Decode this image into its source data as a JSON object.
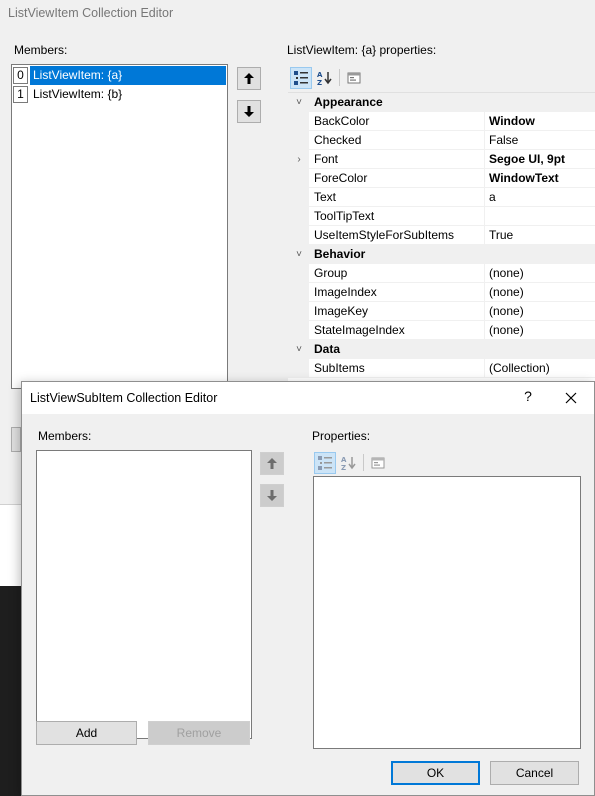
{
  "back_window": {
    "title": "ListViewItem Collection Editor",
    "members_label": "Members:",
    "members": [
      {
        "index": "0",
        "label": "ListViewItem: {a}",
        "selected": true
      },
      {
        "index": "1",
        "label": "ListViewItem: {b}",
        "selected": false
      }
    ],
    "properties_label": "ListViewItem: {a} properties:",
    "property_grid": {
      "categories": [
        {
          "name": "Appearance",
          "properties": [
            {
              "name": "BackColor",
              "value": "Window",
              "bold": true
            },
            {
              "name": "Checked",
              "value": "False",
              "bold": false
            },
            {
              "name": "Font",
              "value": "Segoe UI, 9pt",
              "bold": true,
              "expandable": true
            },
            {
              "name": "ForeColor",
              "value": "WindowText",
              "bold": true
            },
            {
              "name": "Text",
              "value": "a",
              "bold": false
            },
            {
              "name": "ToolTipText",
              "value": "",
              "bold": false
            },
            {
              "name": "UseItemStyleForSubItems",
              "value": "True",
              "bold": false
            }
          ]
        },
        {
          "name": "Behavior",
          "properties": [
            {
              "name": "Group",
              "value": "(none)",
              "bold": false
            },
            {
              "name": "ImageIndex",
              "value": "(none)",
              "bold": false
            },
            {
              "name": "ImageKey",
              "value": "(none)",
              "bold": false
            },
            {
              "name": "StateImageIndex",
              "value": "(none)",
              "bold": false
            }
          ]
        },
        {
          "name": "Data",
          "properties": [
            {
              "name": "SubItems",
              "value": "(Collection)",
              "bold": false
            }
          ]
        }
      ]
    }
  },
  "dialog": {
    "title": "ListViewSubItem Collection Editor",
    "help_glyph": "?",
    "members_label": "Members:",
    "properties_label": "Properties:",
    "add_label": "Add",
    "remove_label": "Remove",
    "ok_label": "OK",
    "cancel_label": "Cancel"
  },
  "icons": {
    "move_up": "arrow-up-icon",
    "move_down": "arrow-down-icon",
    "categorized": "categorized-icon",
    "alphabetical": "alphabetical-sort-icon",
    "property_pages": "property-pages-icon",
    "close": "close-icon",
    "help": "help-icon"
  },
  "colors": {
    "selection": "#0078d7",
    "window_bg": "#f0f0f0",
    "default_button_border": "#0078d7"
  }
}
